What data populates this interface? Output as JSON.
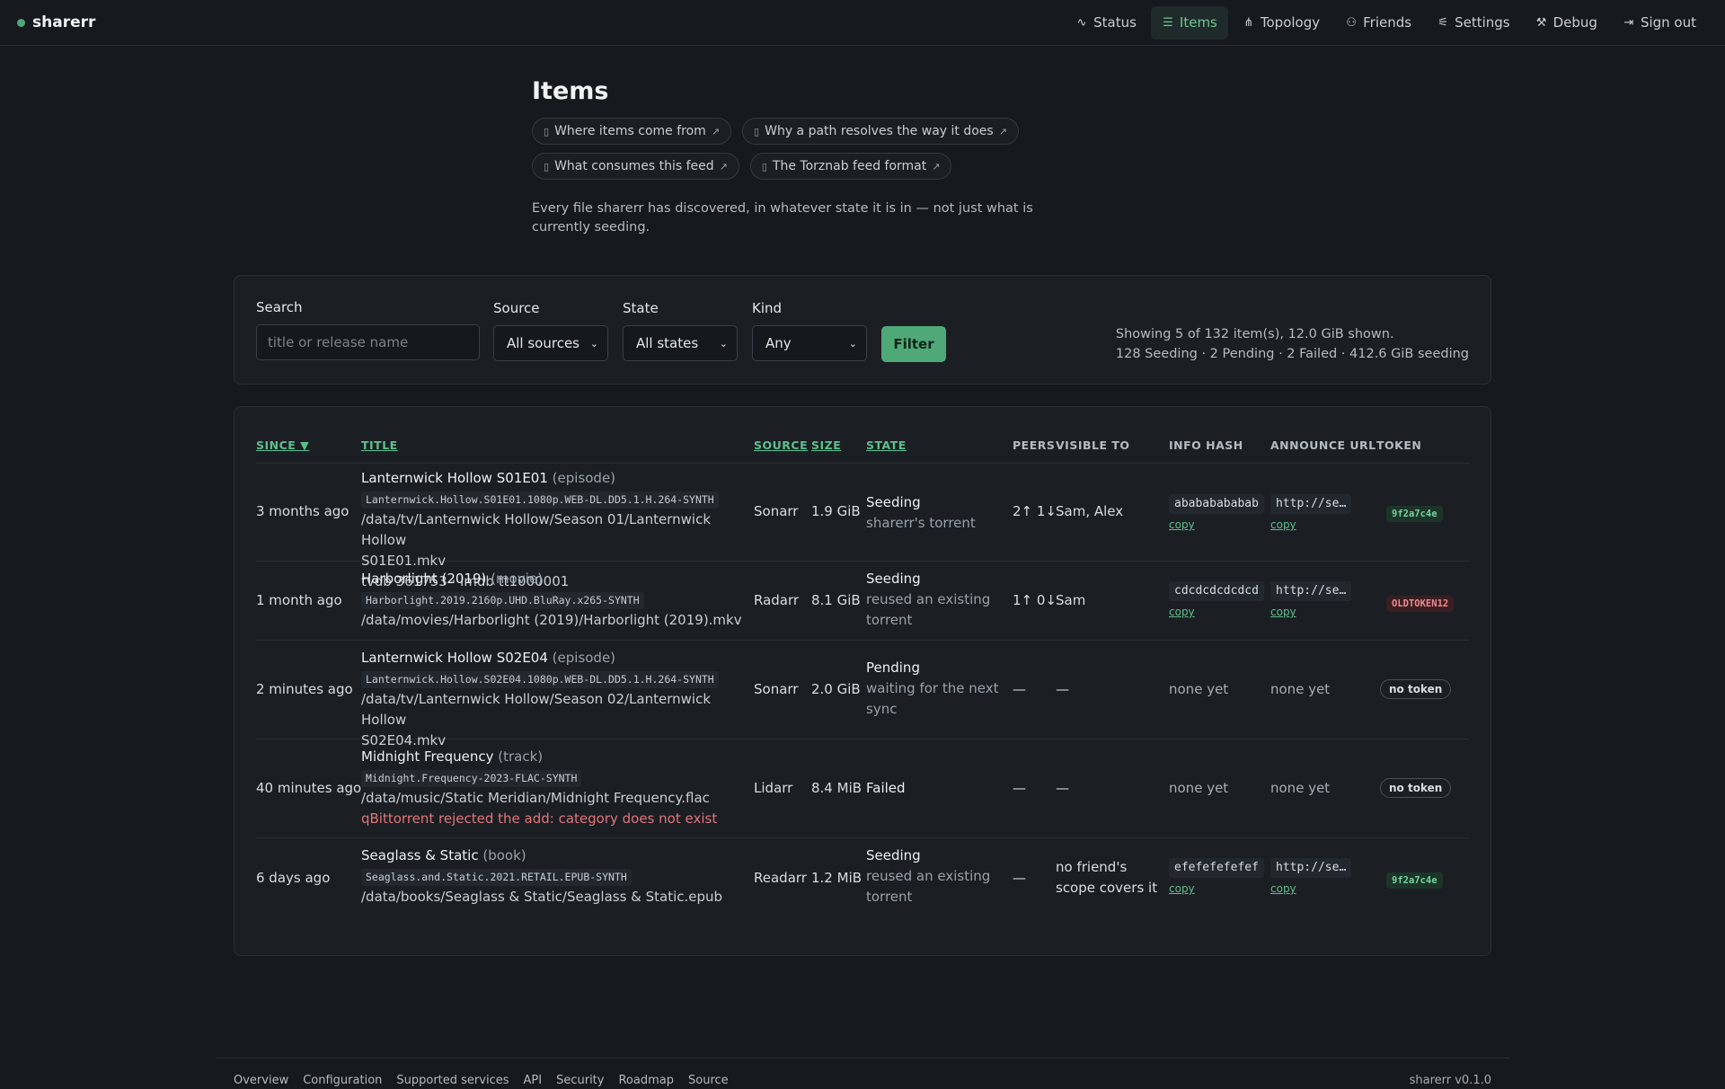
{
  "app": {
    "name": "sharerr",
    "version": "sharerr v0.1.0",
    "accent_color": "#4fa878",
    "danger_color": "#e2757a"
  },
  "nav": [
    {
      "label": "Status",
      "icon": "activity-icon",
      "active": false
    },
    {
      "label": "Items",
      "icon": "list-icon",
      "active": true
    },
    {
      "label": "Topology",
      "icon": "graph-icon",
      "active": false
    },
    {
      "label": "Friends",
      "icon": "users-icon",
      "active": false
    },
    {
      "label": "Settings",
      "icon": "sliders-icon",
      "active": false
    },
    {
      "label": "Debug",
      "icon": "wrench-icon",
      "active": false
    },
    {
      "label": "Sign out",
      "icon": "sign-out-icon",
      "active": false
    }
  ],
  "page": {
    "title": "Items",
    "doc_links": [
      "Where items come from",
      "Why a path resolves the way it does",
      "What consumes this feed",
      "The Torznab feed format"
    ],
    "lead": "Every file sharerr has discovered, in whatever state it is in — not just what is currently seeding."
  },
  "filters": {
    "search_label": "Search",
    "search_placeholder": "title or release name",
    "source_label": "Source",
    "source_value": "All sources",
    "state_label": "State",
    "state_value": "All states",
    "kind_label": "Kind",
    "kind_value": "Any",
    "filter_button": "Filter",
    "stats_line1": "Showing 5 of 132 item(s), 12.0 GiB shown.",
    "stats_line2": "128 Seeding · 2 Pending · 2 Failed · 412.6 GiB seeding"
  },
  "table": {
    "headers": {
      "since": "SINCE ▼",
      "title": "TITLE",
      "source": "SOURCE",
      "size": "SIZE",
      "state": "STATE",
      "peers": "PEERS",
      "visible_to": "VISIBLE TO",
      "info_hash": "INFO HASH",
      "announce_url": "ANNOUNCE URL",
      "token": "TOKEN"
    },
    "rows": [
      {
        "since": "3 months ago",
        "title": "Lanternwick Hollow S01E01",
        "kind": "(episode)",
        "release": "Lanternwick.Hollow.S01E01.1080p.WEB-DL.DD5.1.H.264-SYNTH",
        "path1": "/data/tv/Lanternwick Hollow/Season 01/Lanternwick Hollow",
        "path2": "S01E01.mkv",
        "extra": "tvdb 361753 · imdb tt1000001",
        "source": "Sonarr",
        "size": "1.9 GiB",
        "state": "Seeding",
        "state_sub1": "sharerr's torrent",
        "state_sub2": "",
        "peers": "2↑ 1↓",
        "visible1": "Sam, Alex",
        "visible2": "",
        "hash": "abababababab",
        "hash_copy": "copy",
        "announce": "http://se…",
        "announce_copy": "copy",
        "token": "9f2a7c4e",
        "token_kind": "ok"
      },
      {
        "since": "1 month ago",
        "title": "Harborlight (2019)",
        "kind": "(movie)",
        "release": "Harborlight.2019.2160p.UHD.BluRay.x265-SYNTH",
        "path1": "/data/movies/Harborlight (2019)/Harborlight (2019).mkv",
        "path2": "",
        "extra": "",
        "source": "Radarr",
        "size": "8.1 GiB",
        "state": "Seeding",
        "state_sub1": "reused an existing",
        "state_sub2": "torrent",
        "peers": "1↑ 0↓",
        "visible1": "Sam",
        "visible2": "",
        "hash": "cdcdcdcdcdcd",
        "hash_copy": "copy",
        "announce": "http://se…",
        "announce_copy": "copy",
        "token": "OLDTOKEN12",
        "token_kind": "old"
      },
      {
        "since": "2 minutes ago",
        "title": "Lanternwick Hollow S02E04",
        "kind": "(episode)",
        "release": "Lanternwick.Hollow.S02E04.1080p.WEB-DL.DD5.1.H.264-SYNTH",
        "path1": "/data/tv/Lanternwick Hollow/Season 02/Lanternwick Hollow",
        "path2": "S02E04.mkv",
        "extra": "",
        "source": "Sonarr",
        "size": "2.0 GiB",
        "state": "Pending",
        "state_sub1": "waiting for the next",
        "state_sub2": "sync",
        "peers": "—",
        "visible1": "—",
        "visible2": "",
        "hash_none": "none yet",
        "announce_none": "none yet",
        "token": "no token",
        "token_kind": "none"
      },
      {
        "since": "40 minutes ago",
        "title": "Midnight Frequency",
        "kind": "(track)",
        "release": "Midnight.Frequency-2023-FLAC-SYNTH",
        "path1": "/data/music/Static Meridian/Midnight Frequency.flac",
        "path2": "",
        "error": "qBittorrent rejected the add: category does not exist",
        "source": "Lidarr",
        "size": "8.4 MiB",
        "state": "Failed",
        "state_sub1": "",
        "state_sub2": "",
        "peers": "—",
        "visible1": "—",
        "visible2": "",
        "hash_none": "none yet",
        "announce_none": "none yet",
        "token": "no token",
        "token_kind": "none"
      },
      {
        "since": "6 days ago",
        "title": "Seaglass & Static",
        "kind": "(book)",
        "release": "Seaglass.and.Static.2021.RETAIL.EPUB-SYNTH",
        "path1": "/data/books/Seaglass & Static/Seaglass & Static.epub",
        "path2": "",
        "extra": "",
        "source": "Readarr",
        "size": "1.2 MiB",
        "state": "Seeding",
        "state_sub1": "reused an existing",
        "state_sub2": "torrent",
        "peers": "—",
        "visible1": "no friend's",
        "visible2": "scope covers it",
        "hash": "efefefefefef",
        "hash_copy": "copy",
        "announce": "http://se…",
        "announce_copy": "copy",
        "token": "9f2a7c4e",
        "token_kind": "ok"
      }
    ]
  },
  "footer": {
    "links": [
      "Overview",
      "Configuration",
      "Supported services",
      "API",
      "Security",
      "Roadmap",
      "Source"
    ],
    "version": "sharerr v0.1.0"
  }
}
